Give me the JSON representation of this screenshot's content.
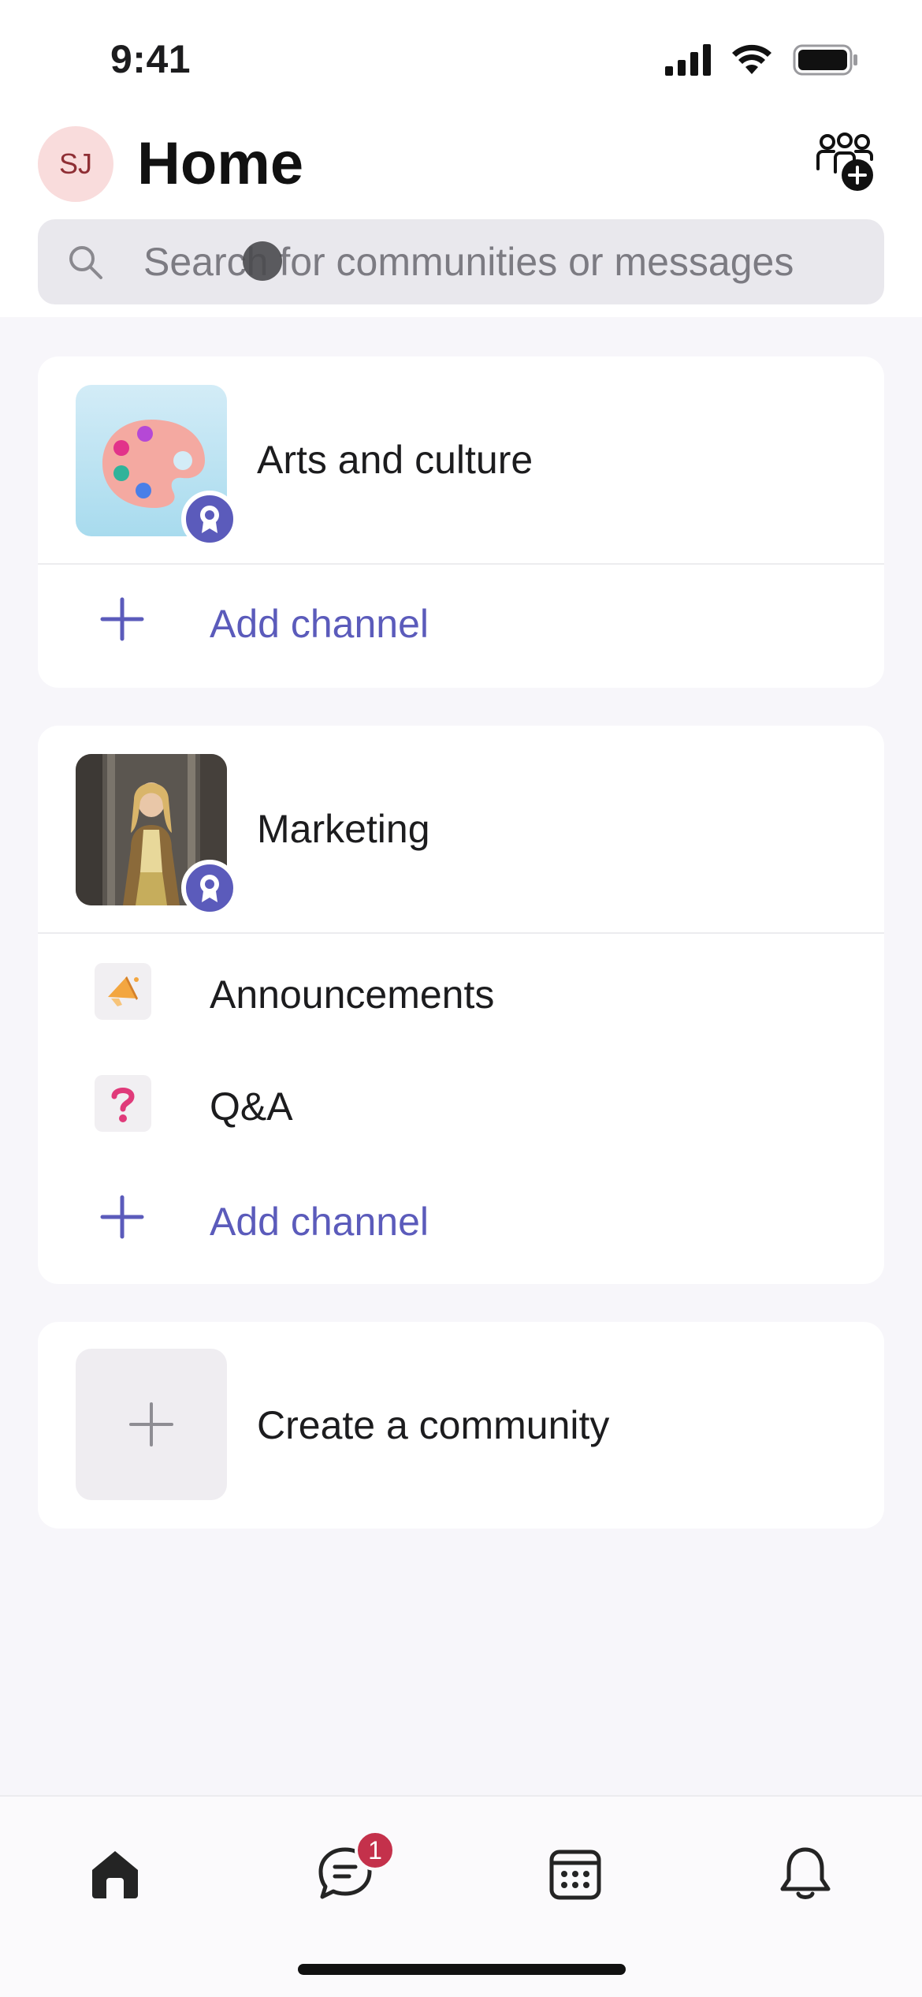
{
  "status_bar": {
    "time": "9:41"
  },
  "header": {
    "avatar_initials": "SJ",
    "title": "Home"
  },
  "search": {
    "placeholder": "Search for communities or messages"
  },
  "communities": [
    {
      "name": "Arts and culture",
      "thumbnail": "palette-image",
      "channels": [],
      "add_channel_label": "Add channel"
    },
    {
      "name": "Marketing",
      "thumbnail": "portrait-photo",
      "channels": [
        {
          "label": "Announcements",
          "icon": "megaphone-icon"
        },
        {
          "label": "Q&A",
          "icon": "question-mark-icon"
        }
      ],
      "add_channel_label": "Add channel"
    }
  ],
  "create_community": {
    "label": "Create a community"
  },
  "tabbar": {
    "tabs": [
      {
        "name": "home",
        "icon": "home-icon",
        "active": true
      },
      {
        "name": "chat",
        "icon": "chat-icon",
        "badge": "1"
      },
      {
        "name": "calendar",
        "icon": "calendar-icon"
      },
      {
        "name": "activity",
        "icon": "bell-icon"
      }
    ]
  },
  "colors": {
    "accent": "#5b5bbb",
    "badge_red": "#c4314b",
    "avatar_bg": "#f9dcdc"
  }
}
